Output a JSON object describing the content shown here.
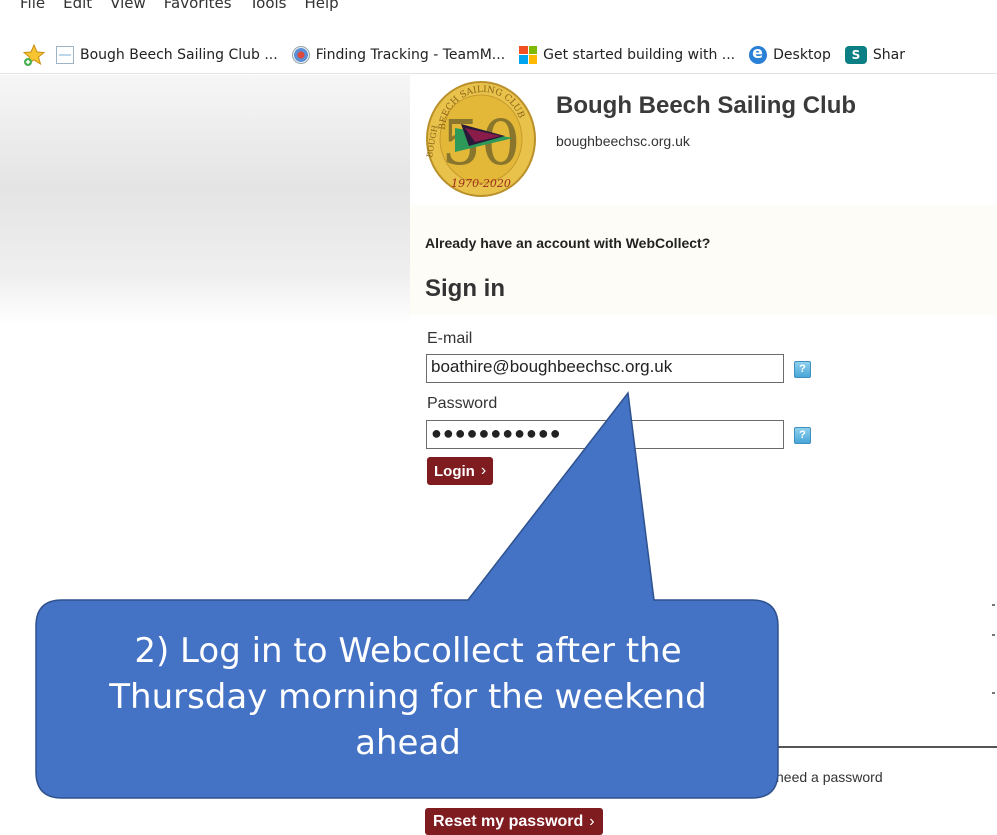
{
  "browser": {
    "menu": [
      "File",
      "Edit",
      "View",
      "Favorites",
      "Tools",
      "Help"
    ],
    "favorites": [
      {
        "label": "Bough Beech Sailing Club ...",
        "icon": "page-icon"
      },
      {
        "label": "Finding Tracking - TeamM...",
        "icon": "tracking-icon"
      },
      {
        "label": "Get started building with ...",
        "icon": "microsoft-icon"
      },
      {
        "label": "Desktop",
        "icon": "ie-icon"
      },
      {
        "label": "Shar",
        "icon": "sharepoint-icon"
      }
    ],
    "sharepoint_glyph": "S"
  },
  "club": {
    "name": "Bough Beech Sailing Club",
    "url": "boughbeechsc.org.uk",
    "logo": {
      "ring_text": "BEECH SAILING CLUB",
      "number": "50",
      "years": "1970-2020",
      "left_text": "BOUGH"
    }
  },
  "signin": {
    "prompt": "Already have an account with WebCollect?",
    "title": "Sign in",
    "email_label": "E-mail",
    "email_value": "boathire@boughbeechsc.org.uk",
    "password_label": "Password",
    "password_mask": "●●●●●●●●●●●",
    "help_glyph": "?",
    "login_label": "Login",
    "chevron": "›"
  },
  "reset": {
    "need_password_text": "need a password",
    "button_label": "Reset my password"
  },
  "callout": {
    "lines": [
      "2) Log in to Webcollect after the",
      "Thursday morning for the weekend",
      "ahead"
    ],
    "fill": "#4472c4",
    "stroke": "#2f528f"
  }
}
